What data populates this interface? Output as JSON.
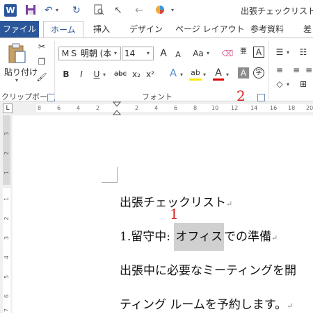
{
  "title_bar": {
    "document_title": "出張チェックリスト最",
    "app_logo": "W"
  },
  "quick_access": {
    "icons": [
      "save-icon",
      "undo-icon",
      "redo-icon",
      "print-preview-icon",
      "pointer-icon",
      "back-icon",
      "color-icon"
    ]
  },
  "tabs": {
    "file": "ファイル",
    "items": [
      {
        "label": "ホーム"
      },
      {
        "label": "挿入"
      },
      {
        "label": "デザイン"
      },
      {
        "label": "ページ レイアウト"
      },
      {
        "label": "参考資料"
      },
      {
        "label": "差"
      }
    ]
  },
  "ribbon": {
    "clipboard": {
      "paste_label": "貼り付け",
      "group_label": "クリップボード"
    },
    "font": {
      "font_name": "ＭＳ 明朝 (本",
      "font_size": "14",
      "group_label": "フォント",
      "format_buttons": [
        "B",
        "I",
        "U",
        "abc",
        "x₂",
        "x²"
      ],
      "grow": "A",
      "shrink": "A",
      "case": "Aa",
      "text_effect": "A",
      "highlight": "ab",
      "font_color": "A",
      "char_shade": "A",
      "enclose": "字"
    }
  },
  "ruler": {
    "ticks": [
      "8",
      "6",
      "4",
      "2",
      "2",
      "4",
      "6",
      "8",
      "10",
      "12",
      "14",
      "16",
      "18",
      "20"
    ],
    "vticks": [
      "3",
      "2",
      "1",
      "1",
      "2",
      "3",
      "4",
      "5",
      "6",
      "7"
    ]
  },
  "callouts": {
    "one": "1",
    "two": "2"
  },
  "document": {
    "line1": "出張チェックリスト",
    "line2_prefix": "1.留守中: ",
    "line2_selected": "オフィス",
    "line2_suffix": "での準備",
    "line3": "出張中に必要なミーティングを開",
    "line4": "ティング ルームを予約します。",
    "para_mark": "↵"
  },
  "colors": {
    "accent": "#2b579a",
    "callout": "#e02020",
    "selection": "#d0d0d0"
  }
}
